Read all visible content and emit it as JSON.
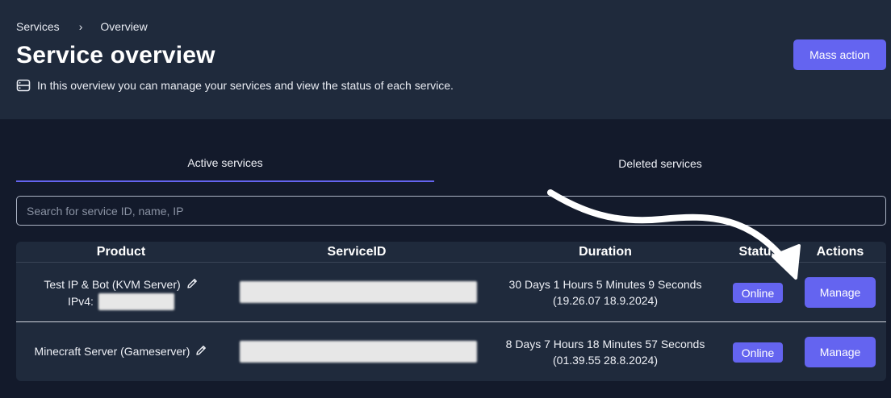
{
  "breadcrumb": {
    "items": [
      "Services",
      "Overview"
    ],
    "separator": "›"
  },
  "page": {
    "title": "Service overview",
    "subtitle": "In this overview you can manage your services and view the status of each service."
  },
  "toolbar": {
    "mass_action_label": "Mass action"
  },
  "tabs": [
    {
      "label": "Active services",
      "active": true
    },
    {
      "label": "Deleted services",
      "active": false
    }
  ],
  "search": {
    "placeholder": "Search for service ID, name, IP",
    "value": ""
  },
  "table": {
    "headers": [
      "Product",
      "ServiceID",
      "Duration",
      "Status",
      "Actions"
    ],
    "rows": [
      {
        "product": "Test IP & Bot (KVM Server)",
        "ipv4_label": "IPv4:",
        "duration": "30 Days 1 Hours 5 Minutes 9 Seconds",
        "duration_date": "(19.26.07 18.9.2024)",
        "status": "Online",
        "action": "Manage"
      },
      {
        "product": "Minecraft Server (Gameserver)",
        "duration": "8 Days 7 Hours 18 Minutes 57 Seconds",
        "duration_date": "(01.39.55 28.8.2024)",
        "status": "Online",
        "action": "Manage"
      }
    ]
  },
  "colors": {
    "accent": "#6464f0",
    "header_bg": "#1f2a3c",
    "page_bg": "#131a2b"
  },
  "icons": {
    "subtitle": "server-icon",
    "edit": "pencil-icon",
    "breadcrumb": "chevron-right-icon"
  }
}
